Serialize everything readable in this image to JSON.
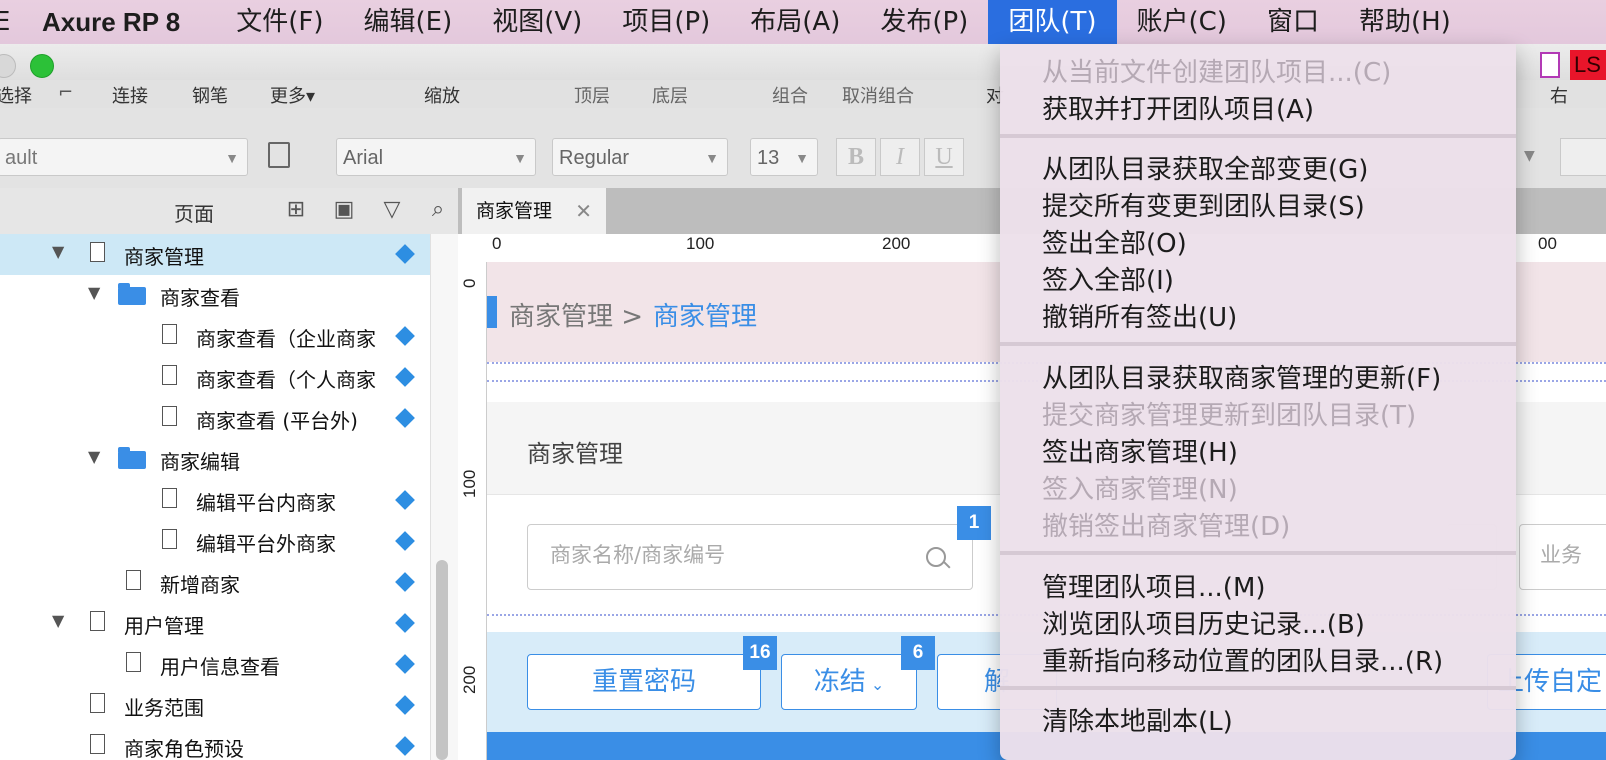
{
  "menubar": {
    "edge_char": "E",
    "app_name": "Axure RP 8",
    "items": [
      "文件(F)",
      "编辑(E)",
      "视图(V)",
      "项目(P)",
      "布局(A)",
      "发布(P)",
      "团队(T)",
      "账户(C)",
      "窗口",
      "帮助(H)"
    ],
    "active_index": 6
  },
  "toolbar": {
    "labels": [
      "选择",
      "连接",
      "钢笔",
      "更多▾",
      "缩放",
      "顶层",
      "底层",
      "组合",
      "取消组合",
      "对",
      "右"
    ],
    "right_badge": "LS"
  },
  "format": {
    "style_value": "ault",
    "font_value": "Arial",
    "weight_value": "Regular",
    "size_value": "13",
    "bold": "B",
    "italic": "I",
    "underline": "U"
  },
  "pages_panel": {
    "title": "页面",
    "tree": [
      {
        "label": "商家管理",
        "type": "page",
        "level": 0,
        "expanded": true,
        "selected": true
      },
      {
        "label": "商家查看",
        "type": "folder",
        "level": 1,
        "expanded": true
      },
      {
        "label": "商家查看（企业商家",
        "type": "page",
        "level": 2
      },
      {
        "label": "商家查看（个人商家",
        "type": "page",
        "level": 2
      },
      {
        "label": "商家查看 (平台外)",
        "type": "page",
        "level": 2
      },
      {
        "label": "商家编辑",
        "type": "folder",
        "level": 1,
        "expanded": true
      },
      {
        "label": "编辑平台内商家",
        "type": "page",
        "level": 2
      },
      {
        "label": "编辑平台外商家",
        "type": "page",
        "level": 2
      },
      {
        "label": "新增商家",
        "type": "page",
        "level": 1
      },
      {
        "label": "用户管理",
        "type": "page",
        "level": 0,
        "expanded": true
      },
      {
        "label": "用户信息查看",
        "type": "page",
        "level": 1
      },
      {
        "label": "业务范围",
        "type": "page",
        "level": 0
      },
      {
        "label": "商家角色预设",
        "type": "page",
        "level": 0
      }
    ]
  },
  "canvas": {
    "tab_label": "商家管理",
    "ruler_h": [
      "0",
      "100",
      "200",
      "00"
    ],
    "ruler_v": [
      "0",
      "100",
      "200"
    ],
    "breadcrumb_parent": "商家管理 >",
    "breadcrumb_current": "商家管理",
    "section_title": "商家管理",
    "search_placeholder": "商家名称/商家编号",
    "right_input_text": "业务",
    "right_button_text": "上传自定",
    "buttons": [
      "重置密码",
      "冻结",
      "解"
    ],
    "badges": [
      "1",
      "16",
      "6"
    ]
  },
  "dropdown": {
    "items": [
      {
        "label": "从当前文件创建团队项目...(C)",
        "disabled": true
      },
      {
        "label": "获取并打开团队项目(A)",
        "disabled": false
      },
      {
        "label": "从团队目录获取全部变更(G)",
        "disabled": false
      },
      {
        "label": "提交所有变更到团队目录(S)",
        "disabled": false
      },
      {
        "label": "签出全部(O)",
        "disabled": false
      },
      {
        "label": "签入全部(I)",
        "disabled": false
      },
      {
        "label": "撤销所有签出(U)",
        "disabled": false
      },
      {
        "label": "从团队目录获取商家管理的更新(F)",
        "disabled": false
      },
      {
        "label": "提交商家管理更新到团队目录(T)",
        "disabled": true
      },
      {
        "label": "签出商家管理(H)",
        "disabled": false
      },
      {
        "label": "签入商家管理(N)",
        "disabled": true
      },
      {
        "label": "撤销签出商家管理(D)",
        "disabled": true
      },
      {
        "label": "管理团队项目...(M)",
        "disabled": false
      },
      {
        "label": "浏览团队项目历史记录...(B)",
        "disabled": false
      },
      {
        "label": "重新指向移动位置的团队目录...(R)",
        "disabled": false
      },
      {
        "label": "清除本地副本(L)",
        "disabled": false
      }
    ]
  },
  "colors": {
    "accent": "#3a8ee6",
    "menu_active": "#2a6ee0",
    "menubar_bg": "#e6cce0"
  }
}
